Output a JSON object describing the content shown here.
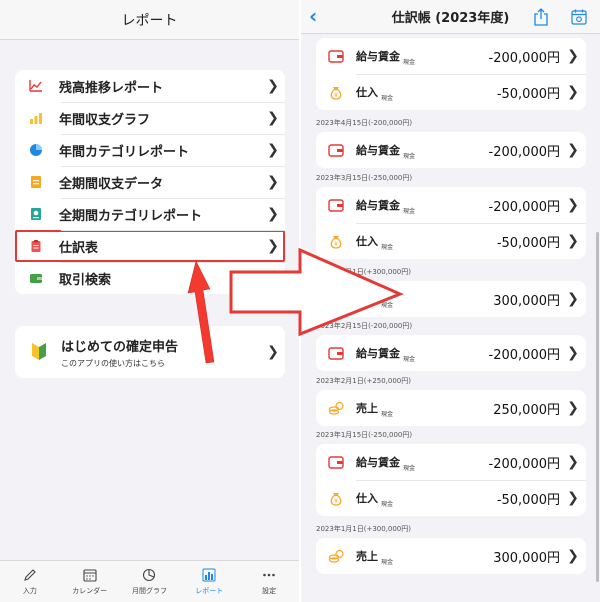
{
  "left": {
    "header_title": "レポート",
    "menu": [
      {
        "label": "残高推移レポート",
        "icon": "line-chart-icon"
      },
      {
        "label": "年間収支グラフ",
        "icon": "bar-chart-icon"
      },
      {
        "label": "年間カテゴリレポート",
        "icon": "pie-chart-icon"
      },
      {
        "label": "全期間収支データ",
        "icon": "document-icon"
      },
      {
        "label": "全期間カテゴリレポート",
        "icon": "report-icon"
      },
      {
        "label": "仕訳表",
        "icon": "ledger-icon",
        "selected": true
      },
      {
        "label": "取引検索",
        "icon": "wallet-icon"
      }
    ],
    "guide": {
      "title": "はじめての確定申告",
      "subtitle": "このアプリの使い方はこちら"
    },
    "tabs": [
      {
        "label": "入力",
        "icon": "pencil-icon"
      },
      {
        "label": "カレンダー",
        "icon": "calendar-icon"
      },
      {
        "label": "月間グラフ",
        "icon": "pie-icon"
      },
      {
        "label": "レポート",
        "icon": "bar-chart-icon",
        "active": true
      },
      {
        "label": "設定",
        "icon": "more-icon"
      }
    ]
  },
  "right": {
    "header_title": "仕訳帳 (2023年度)",
    "dates": [
      "2023年4月15日(-200,000円)",
      "2023年3月15日(-250,000円)",
      "2023年3月1日(+300,000円)",
      "2023年2月15日(-200,000円)",
      "2023年2月1日(+250,000円)",
      "2023年1月15日(-250,000円)",
      "2023年1月1日(+300,000円)"
    ],
    "groups": [
      [
        {
          "cat": "給与賃金",
          "acct": "現金",
          "amount": "-200,000円",
          "icon": "wallet-icon"
        },
        {
          "cat": "仕入",
          "acct": "現金",
          "amount": "-50,000円",
          "icon": "money-bag-icon"
        }
      ],
      [
        {
          "cat": "給与賃金",
          "acct": "現金",
          "amount": "-200,000円",
          "icon": "wallet-icon"
        }
      ],
      [
        {
          "cat": "給与賃金",
          "acct": "現金",
          "amount": "-200,000円",
          "icon": "wallet-icon"
        },
        {
          "cat": "仕入",
          "acct": "現金",
          "amount": "-50,000円",
          "icon": "money-bag-icon"
        }
      ],
      [
        {
          "cat": "売上",
          "acct": "現金",
          "amount": "300,000円",
          "icon": "coins-icon"
        }
      ],
      [
        {
          "cat": "給与賃金",
          "acct": "現金",
          "amount": "-200,000円",
          "icon": "wallet-icon"
        }
      ],
      [
        {
          "cat": "売上",
          "acct": "現金",
          "amount": "250,000円",
          "icon": "coins-icon"
        }
      ],
      [
        {
          "cat": "給与賃金",
          "acct": "現金",
          "amount": "-200,000円",
          "icon": "wallet-icon"
        },
        {
          "cat": "仕入",
          "acct": "現金",
          "amount": "-50,000円",
          "icon": "money-bag-icon"
        }
      ],
      [
        {
          "cat": "売上",
          "acct": "現金",
          "amount": "300,000円",
          "icon": "coins-icon"
        }
      ]
    ]
  },
  "colors": {
    "accent": "#1e88e5",
    "highlight": "#e53935"
  }
}
